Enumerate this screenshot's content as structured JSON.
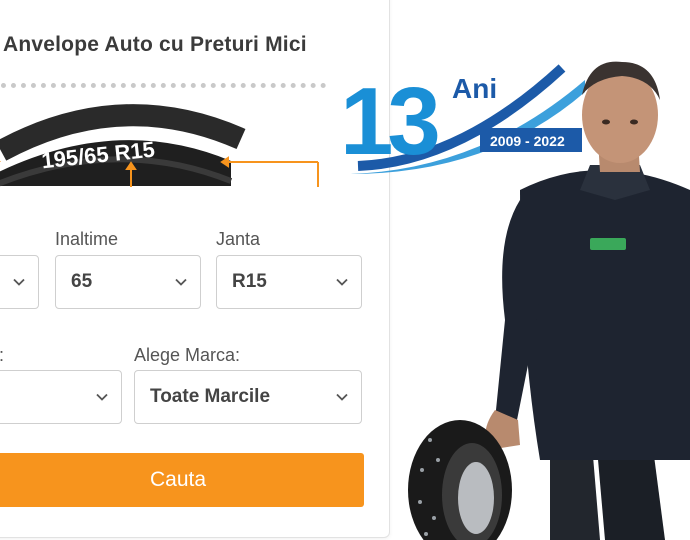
{
  "card": {
    "title": "Anvelope Auto cu Preturi Mici",
    "tire_size_marking": "195/65 R15",
    "fields": {
      "latime": {
        "value": ""
      },
      "inaltime": {
        "label": "Inaltime",
        "value": "65"
      },
      "janta": {
        "label": "Janta",
        "value": "R15"
      },
      "sezon": {
        "label": ":",
        "value": ""
      },
      "marca": {
        "label": "Alege Marca:",
        "value": "Toate Marcile"
      }
    },
    "search_button": "Cauta"
  },
  "logo": {
    "number": "13",
    "word": "Ani",
    "years": "2009 - 2022"
  },
  "colors": {
    "accent_orange": "#f7941d",
    "logo_blue": "#1a8fd6",
    "logo_dark": "#1c5aa8"
  }
}
